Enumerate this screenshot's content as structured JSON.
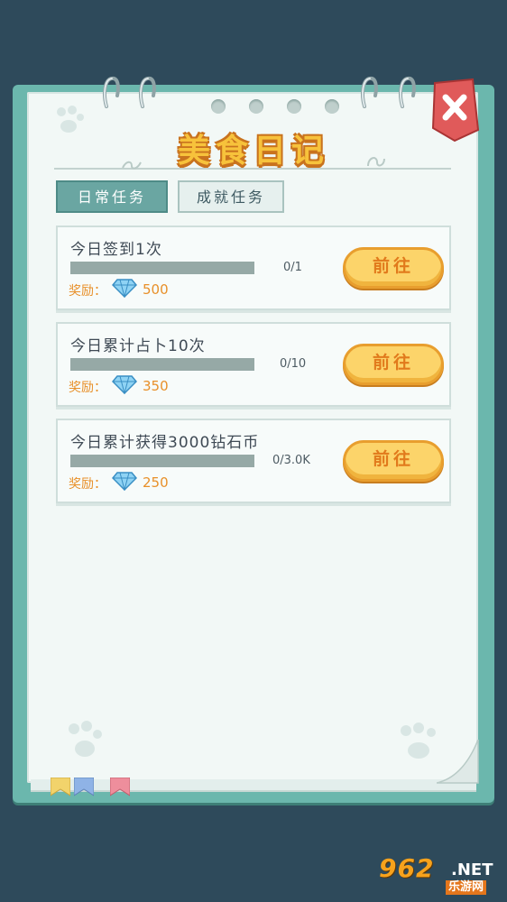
{
  "title": "美食日记",
  "tabs": [
    {
      "label": "日常任务",
      "active": true
    },
    {
      "label": "成就任务",
      "active": false
    }
  ],
  "tasks": [
    {
      "title": "今日签到1次",
      "progress_text": "0/1",
      "progress": 0,
      "reward_label": "奖励：",
      "reward_icon": "diamond-icon",
      "reward_amount": "500",
      "button_label": "前往"
    },
    {
      "title": "今日累计占卜10次",
      "progress_text": "0/10",
      "progress": 0,
      "reward_label": "奖励：",
      "reward_icon": "diamond-icon",
      "reward_amount": "350",
      "button_label": "前往"
    },
    {
      "title": "今日累计获得3000钻石币",
      "progress_text": "0/3.0K",
      "progress": 0,
      "reward_label": "奖励：",
      "reward_icon": "diamond-icon",
      "reward_amount": "250",
      "button_label": "前往"
    }
  ],
  "watermark": {
    "logo": "962",
    "net": ".NET",
    "sub": "乐游网"
  },
  "colors": {
    "background": "#2e4a5b",
    "notebook_frame": "#6bb7ad",
    "title_fill": "#f7c23b",
    "button_fill": "#fcd46a",
    "reward_text": "#e8902a",
    "close_button": "#e05a5a"
  }
}
